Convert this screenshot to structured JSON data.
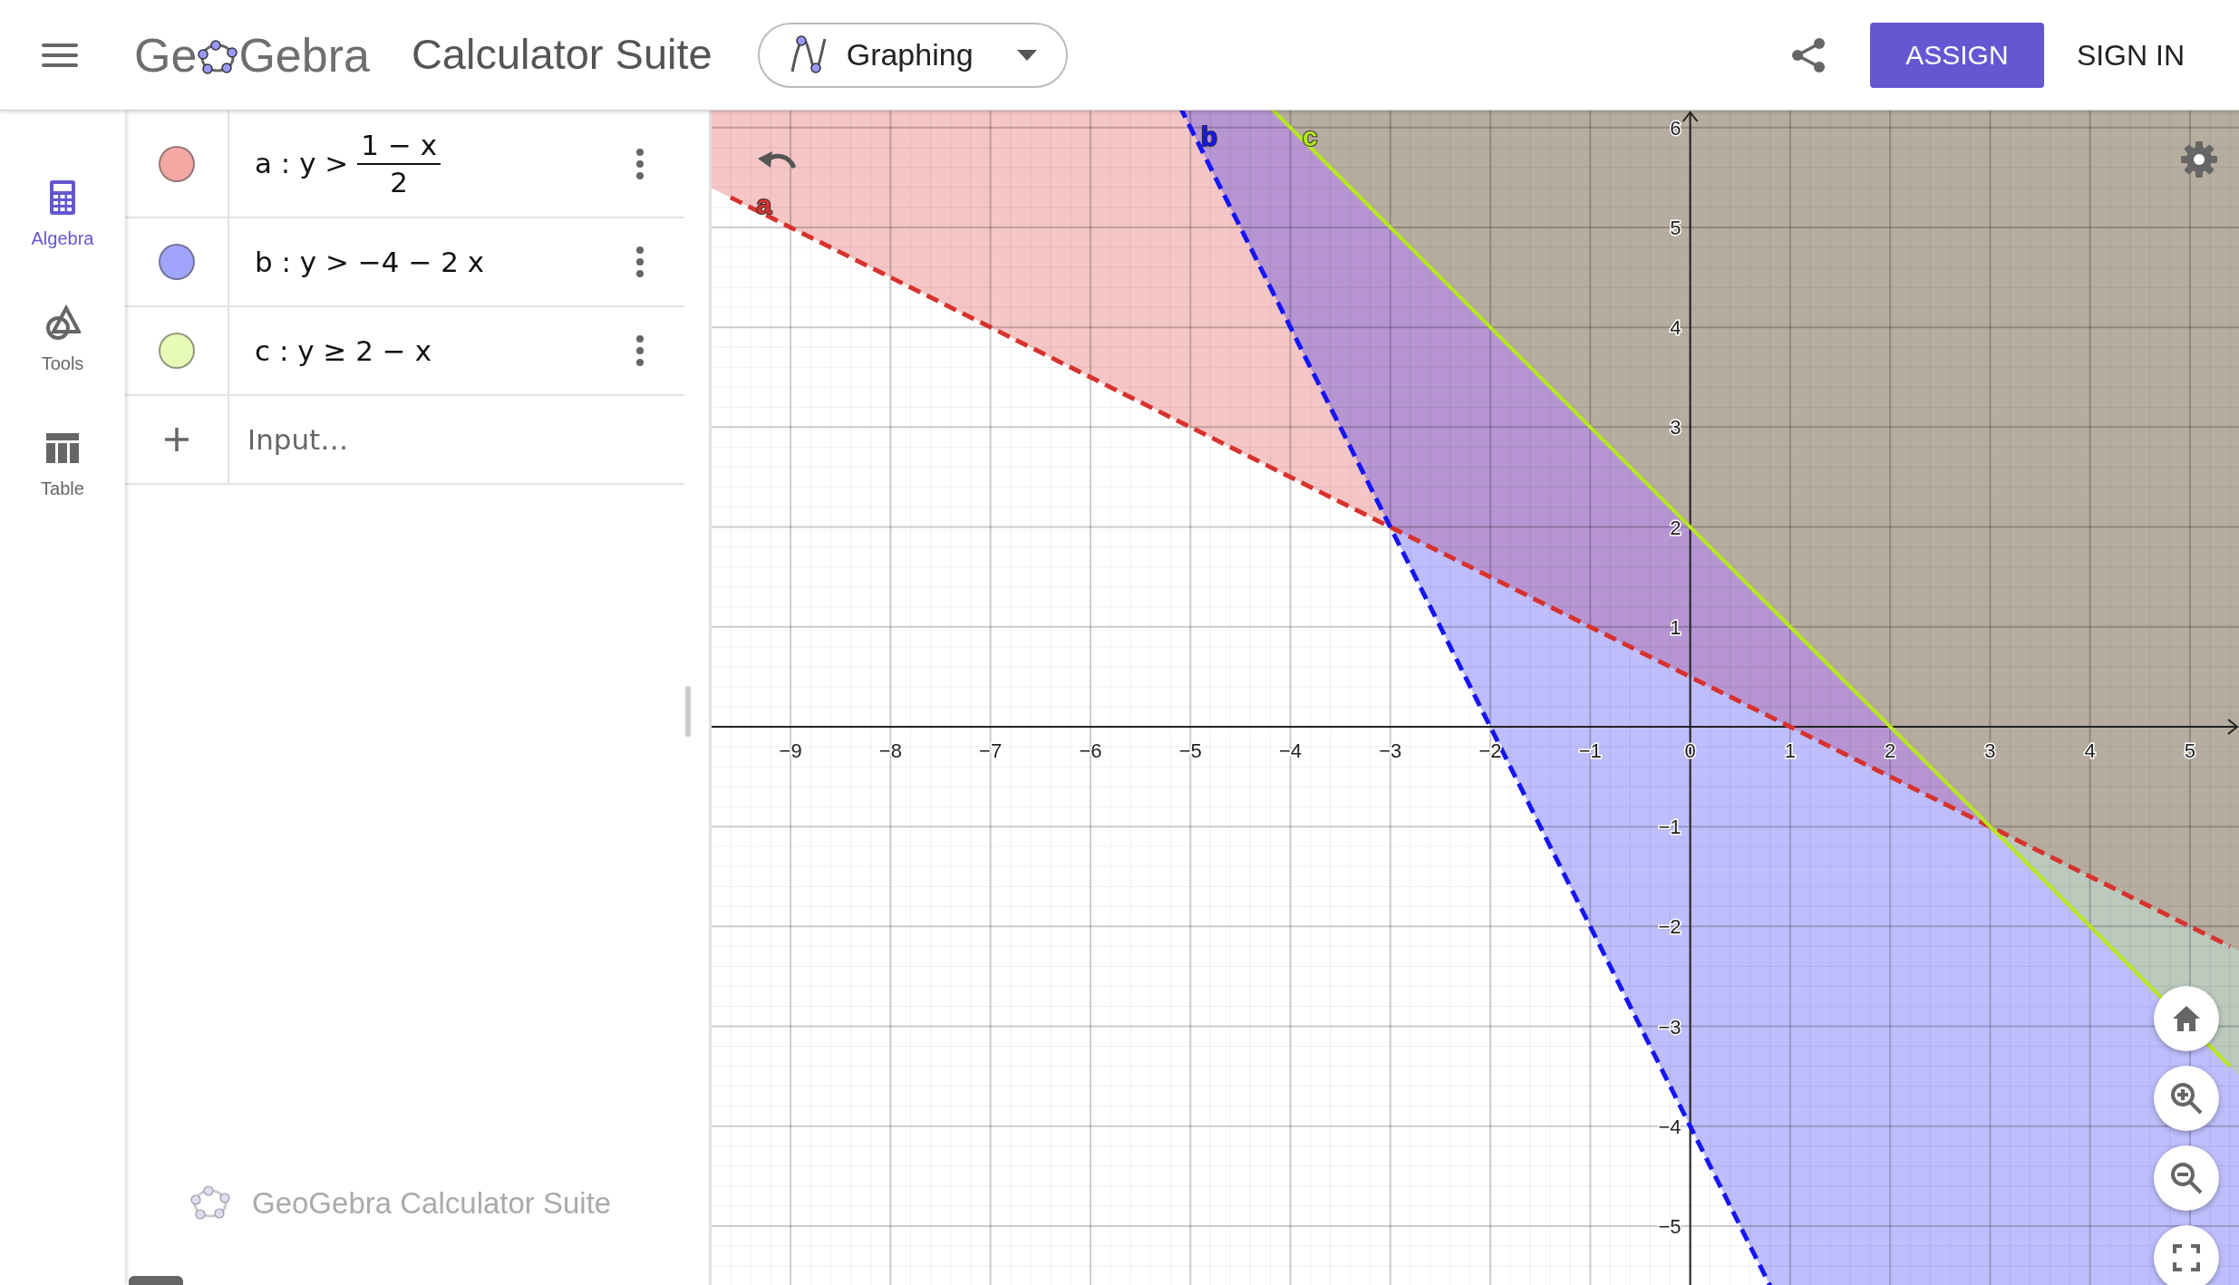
{
  "header": {
    "logo": {
      "before": "Ge",
      "after": "Gebra"
    },
    "title": "Calculator Suite",
    "app_picker": {
      "label": "Graphing"
    },
    "assign_button": "ASSIGN",
    "sign_in": "SIGN IN"
  },
  "rail": [
    {
      "label": "Algebra",
      "selected": true
    },
    {
      "label": "Tools",
      "selected": false
    },
    {
      "label": "Table",
      "selected": false
    }
  ],
  "algebra": {
    "items": [
      {
        "kind": "fraction",
        "color": "#f4a7a3",
        "lhs": "a : y >",
        "numerator": "1 − x",
        "denominator": "2"
      },
      {
        "kind": "plain",
        "color": "#a0a4fb",
        "text": "b : y > −4 − 2 x"
      },
      {
        "kind": "plain",
        "color": "#e7fbb6",
        "text": "c : y ≥ 2 − x"
      }
    ],
    "input": {
      "placeholder": "Input…"
    },
    "footer": "GeoGebra Calculator Suite"
  },
  "graphics": {
    "chart_data": {
      "type": "line",
      "grid": true,
      "x": [
        -9.6,
        -9,
        -5,
        -3.8,
        -3,
        -2,
        0,
        1,
        2,
        3,
        5,
        5.4
      ],
      "series": [
        {
          "name": "a",
          "color": "#d8322e",
          "line_style": "dashed",
          "values": [
            5.3,
            5,
            3,
            2.4,
            2,
            1.5,
            0.5,
            0,
            -0.5,
            -1,
            -2,
            -2.2
          ]
        },
        {
          "name": "b",
          "color": "#1515f5",
          "line_style": "dashed",
          "values": [
            null,
            null,
            6,
            3.6,
            2,
            0,
            -4,
            null,
            null,
            null,
            null,
            null
          ]
        },
        {
          "name": "c",
          "color": "#b6e81e",
          "line_style": "solid",
          "values": [
            null,
            null,
            null,
            5.8,
            5,
            4,
            2,
            1,
            0,
            -1,
            null,
            -3.4
          ]
        }
      ],
      "xlim": [
        -9.79,
        5.49
      ],
      "ylim": [
        -5.59,
        6.17
      ],
      "xticks": [
        {
          "value": -9,
          "label": "−9"
        },
        {
          "value": -8,
          "label": "−8"
        },
        {
          "value": -7,
          "label": "−7"
        },
        {
          "value": -6,
          "label": "−6"
        },
        {
          "value": -5,
          "label": "−5"
        },
        {
          "value": -4,
          "label": "−4"
        },
        {
          "value": -3,
          "label": "−3"
        },
        {
          "value": -2,
          "label": "−2"
        },
        {
          "value": -1,
          "label": "−1"
        },
        {
          "value": 0,
          "label": "0"
        },
        {
          "value": 1,
          "label": "1"
        },
        {
          "value": 2,
          "label": "2"
        },
        {
          "value": 3,
          "label": "3"
        },
        {
          "value": 4,
          "label": "4"
        },
        {
          "value": 5,
          "label": "5"
        }
      ],
      "yticks": [
        {
          "value": 6,
          "label": "6"
        },
        {
          "value": 5,
          "label": "5"
        },
        {
          "value": 4,
          "label": "4"
        },
        {
          "value": 3,
          "label": "3"
        },
        {
          "value": 2,
          "label": "2"
        },
        {
          "value": 1,
          "label": "1"
        },
        {
          "value": -1,
          "label": "−1"
        },
        {
          "value": -2,
          "label": "−2"
        },
        {
          "value": -3,
          "label": "−3"
        },
        {
          "value": -4,
          "label": "−4"
        },
        {
          "value": -5,
          "label": "−5"
        }
      ]
    }
  }
}
